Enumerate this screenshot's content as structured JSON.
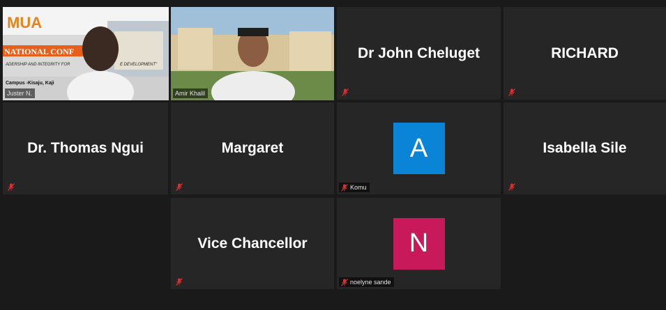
{
  "participants": [
    {
      "display": "Juster N.",
      "has_video": true
    },
    {
      "display": "Amir Khalil",
      "has_video": true
    },
    {
      "name_center": "Dr John Cheluget"
    },
    {
      "name_center": "RICHARD"
    },
    {
      "name_center": "Dr. Thomas Ngui"
    },
    {
      "name_center": "Margaret"
    },
    {
      "avatar_letter": "A",
      "label": "Komu"
    },
    {
      "name_center": "Isabella Sile"
    },
    {
      "name_center": "Vice Chancellor"
    },
    {
      "avatar_letter": "N",
      "label": "noelyne sande"
    }
  ],
  "video1_overlay": {
    "logo": "MUA",
    "heading": "NATIONAL CONF",
    "subheading": "ADERSHIP AND INTEGRITY FOR",
    "tail": "E DEVELOPMENT\"",
    "campus": "Campus -Kisaju, Kaji"
  },
  "colors": {
    "active_border": "#c8e64b",
    "avatar_a": "#0a84d6",
    "avatar_n": "#c8195a",
    "mute_red": "#d93030"
  },
  "icons": {
    "mute": "microphone-muted-icon"
  }
}
